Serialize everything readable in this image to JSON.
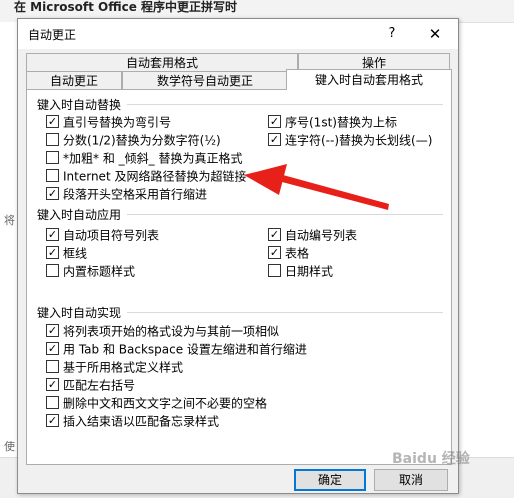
{
  "background": {
    "title": "在 Microsoft Office 程序中更正拼写时",
    "side_letter_1": "将",
    "side_letter_2": "使"
  },
  "dialog": {
    "title": "自动更正",
    "help_label": "?",
    "close_label": "✕",
    "tabs_row1": [
      "自动套用格式",
      "操作"
    ],
    "tabs_row2": [
      "自动更正",
      "数学符号自动更正",
      "键入时自动套用格式"
    ],
    "active_tab": "键入时自动套用格式",
    "groups": {
      "replace": {
        "title": "键入时自动替换",
        "options": [
          {
            "label": "直引号替换为弯引号",
            "checked": true
          },
          {
            "label": "序号(1st)替换为上标",
            "checked": true
          },
          {
            "label": "分数(1/2)替换为分数字符(½)",
            "checked": false
          },
          {
            "label": "连字符(--)替换为长划线(—)",
            "checked": true
          },
          {
            "label": "*加粗* 和 _倾斜_ 替换为真正格式",
            "checked": false
          },
          {
            "label": "Internet 及网络路径替换为超链接",
            "checked": false
          },
          {
            "label": "段落开头空格采用首行缩进",
            "checked": true
          }
        ]
      },
      "apply": {
        "title": "键入时自动应用",
        "options": [
          {
            "label": "自动项目符号列表",
            "checked": true
          },
          {
            "label": "自动编号列表",
            "checked": true
          },
          {
            "label": "框线",
            "checked": true
          },
          {
            "label": "表格",
            "checked": true
          },
          {
            "label": "内置标题样式",
            "checked": false
          },
          {
            "label": "日期样式",
            "checked": false
          }
        ]
      },
      "implement": {
        "title": "键入时自动实现",
        "options": [
          {
            "label": "将列表项开始的格式设为与其前一项相似",
            "checked": true
          },
          {
            "label": "用 Tab 和 Backspace 设置左缩进和首行缩进",
            "checked": true
          },
          {
            "label": "基于所用格式定义样式",
            "checked": false
          },
          {
            "label": "匹配左右括号",
            "checked": true
          },
          {
            "label": "删除中文和西文文字之间不必要的空格",
            "checked": false
          },
          {
            "label": "插入结束语以匹配备忘录样式",
            "checked": true
          }
        ]
      }
    },
    "buttons": {
      "ok": "确定",
      "cancel": "取消"
    }
  },
  "annotation": {
    "color": "#e8201a"
  },
  "watermark": "Baidu 经验"
}
